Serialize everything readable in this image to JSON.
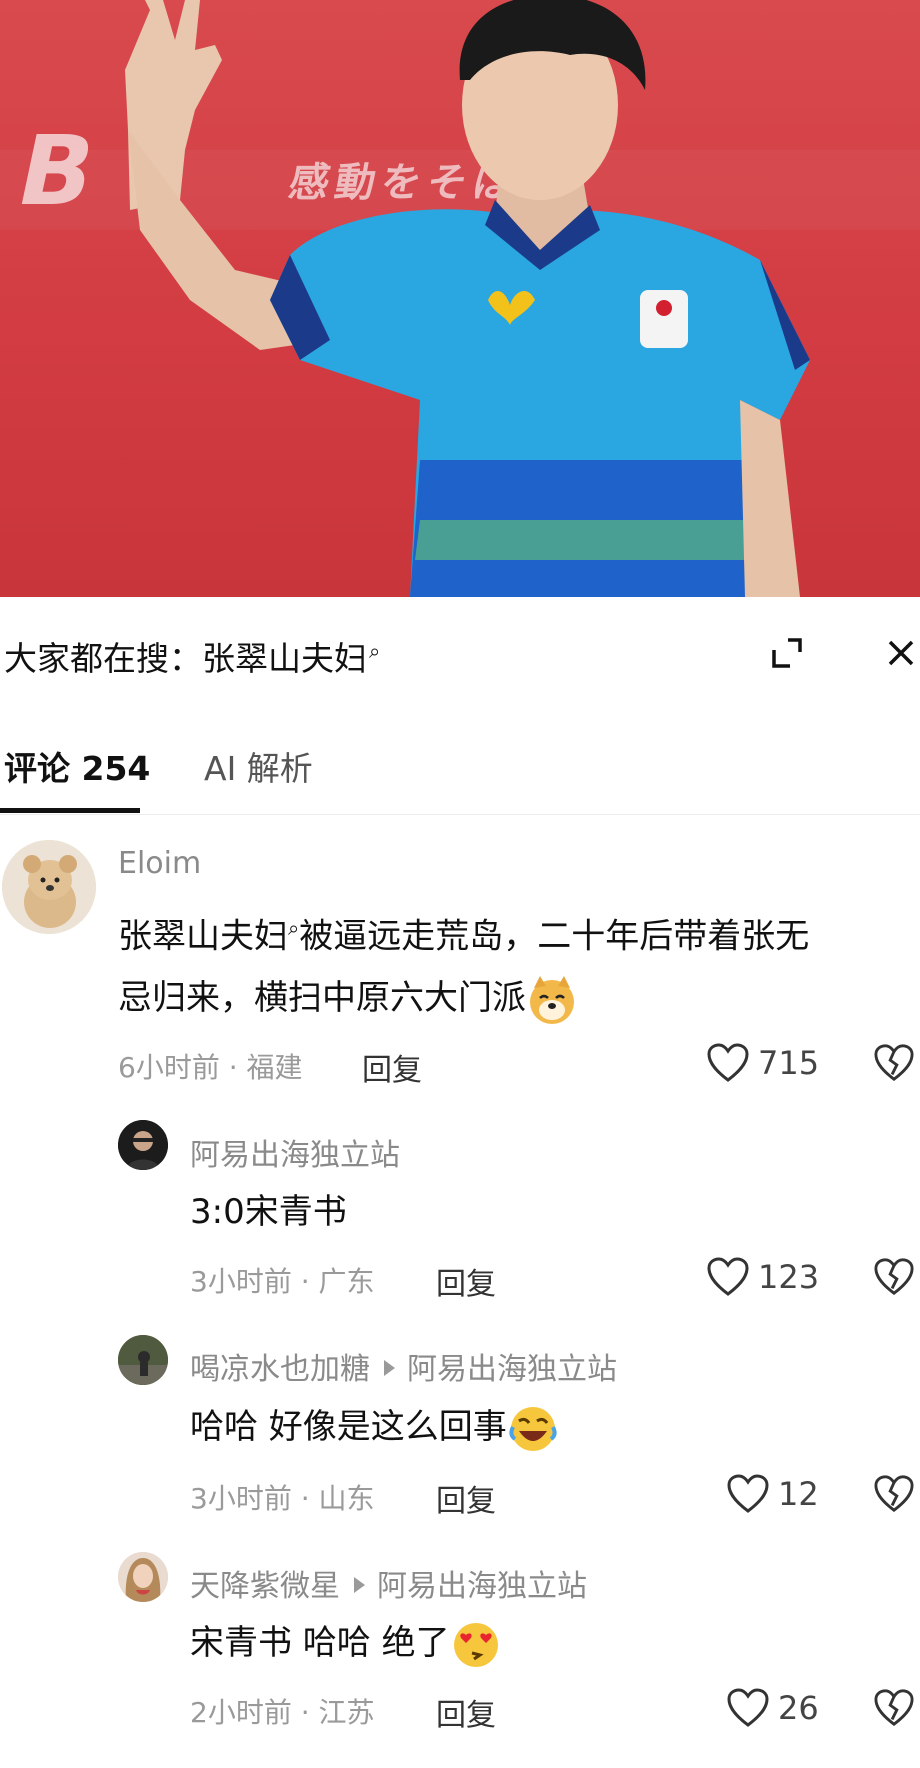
{
  "video": {
    "banner_text": "感動をそばに、",
    "board_logo": "B"
  },
  "search": {
    "prefix": "大家都在搜：",
    "term": "张翠山夫妇",
    "search_icon": "search-icon"
  },
  "tabs": [
    {
      "label": "评论 254",
      "active": true
    },
    {
      "label": "AI 解析",
      "active": false
    }
  ],
  "comments": [
    {
      "username": "Eloim",
      "text_line1_a": "张翠山夫妇",
      "text_line1_b": "被逼远走荒岛，二十年后带着张无",
      "text_line2": "忌归来，横扫中原六大门派",
      "emoji": "doge-emoji",
      "time": "6小时前 · 福建",
      "reply_label": "回复",
      "likes": "715"
    },
    {
      "username": "阿易出海独立站",
      "text": "3:0宋青书",
      "time": "3小时前 · 广东",
      "reply_label": "回复",
      "likes": "123"
    },
    {
      "username": "喝凉水也加糖",
      "reply_to": "阿易出海独立站",
      "text": "哈哈 好像是这么回事",
      "emoji": "rolling-laugh-emoji",
      "time": "3小时前 · 山东",
      "reply_label": "回复",
      "likes": "12"
    },
    {
      "username": "天降紫微星",
      "reply_to": "阿易出海独立站",
      "text": "宋青书 哈哈 绝了",
      "emoji": "heart-eyes-emoji",
      "time": "2小时前 · 江苏",
      "reply_label": "回复",
      "likes": "26"
    }
  ]
}
